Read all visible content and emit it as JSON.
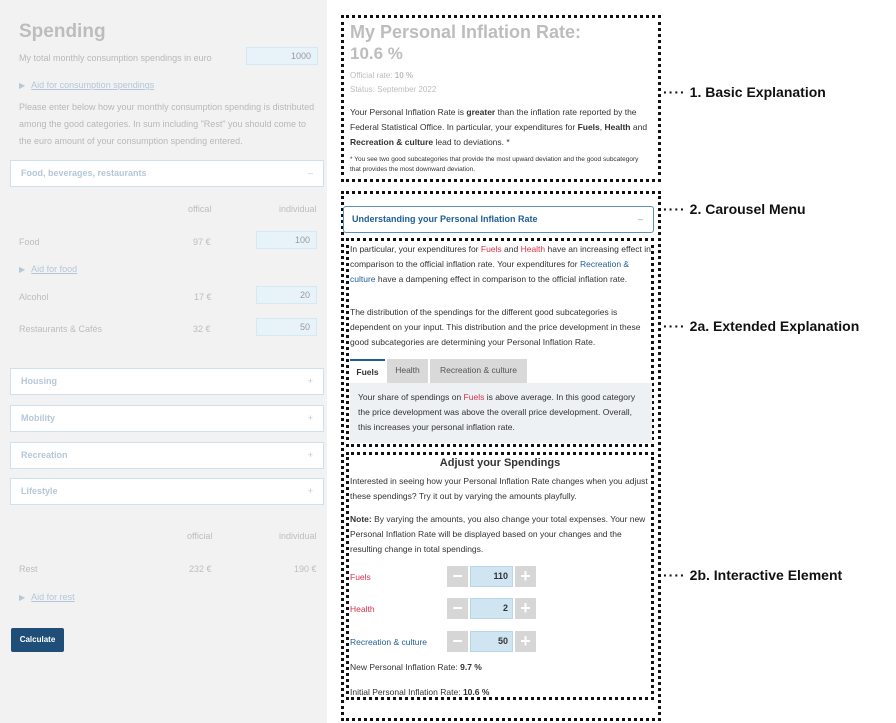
{
  "spending": {
    "title": "Spending",
    "total_label": "My total monthly consumption spendings in euro",
    "total_value": "1000",
    "aid_consumption": "Aid for consumption spendings",
    "instructions": "Please enter below how your monthly consumption spending is distributed among the good categories. In sum including \"Rest\" you should come to the euro amount of your consumption spending entered.",
    "categories": {
      "food": {
        "label": "Food, beverages, restaurants",
        "sign": "–"
      },
      "housing": {
        "label": "Housing",
        "sign": "+"
      },
      "mobility": {
        "label": "Mobility",
        "sign": "+"
      },
      "recreation": {
        "label": "Recreation",
        "sign": "+"
      },
      "lifestyle": {
        "label": "Lifestyle",
        "sign": "+"
      }
    },
    "food_table": {
      "col_official": "offical",
      "col_individual": "individual",
      "rows": [
        {
          "name": "Food",
          "official": "97 €",
          "individual": "100"
        },
        {
          "name": "Alcohol",
          "official": "17 €",
          "individual": "20"
        },
        {
          "name": "Restaurants & Cafés",
          "official": "32 €",
          "individual": "50"
        }
      ],
      "aid_food": "Aid for food"
    },
    "rest_table": {
      "col_official": "official",
      "col_individual": "individual",
      "name": "Rest",
      "official": "232 €",
      "individual": "190 €",
      "aid_rest": "Aid for rest"
    },
    "calculate": "Calculate"
  },
  "result": {
    "title": "My Personal Inflation Rate:",
    "rate": "10.6 %",
    "official_rate_label": "Official rate:",
    "official_rate_value": "10 %",
    "status": "Status: September 2022",
    "basic_1": "Your Personal Inflation Rate is ",
    "basic_greater": "greater",
    "basic_2": " than the inflation rate reported by the Federal Statistical Office. In particular, your expenditures for ",
    "basic_fuels": "Fuels",
    "basic_3": ",",
    "basic_health": "Health",
    "basic_4": " and ",
    "basic_rec": "Recreation & culture",
    "basic_5": " lead to deviations. *",
    "footnote": "* You see two good subcategories that provide the most upward deviation and the good subcategory that provides the most downward deviation."
  },
  "carousel": {
    "label": "Understanding your Personal Inflation Rate",
    "sign": "–"
  },
  "extended": {
    "p1_a": "In particular, your expenditures for ",
    "fuels": "Fuels",
    "p1_b": " and ",
    "health": "Health",
    "p1_c": " have an increasing effect in comparison to the official inflation rate. Your expenditures for ",
    "rec": "Recreation & culture",
    "p1_d": " have a dampening effect in comparison to the official inflation rate.",
    "p2": "The distribution of the spendings for the different good subcategories is dependent on your input. This distribution and the price development in these good subcategories are determining your Personal Inflation Rate.",
    "tabs": [
      "Fuels",
      "Health",
      "Recreation & culture"
    ],
    "panel_a": "Your share of spendings on ",
    "panel_fuels": "Fuels",
    "panel_b": " is above average. In this good category the price development was above the overall price development. Overall, this increases your personal inflation rate."
  },
  "adjust": {
    "title": "Adjust your Spendings",
    "intro": "Interested in seeing how your Personal Inflation Rate changes when you adjust these spendings? Try it out by varying the amounts playfully.",
    "note_label": "Note:",
    "note_text": " By varying the amounts, you also change your total expenses. Your new Personal Inflation Rate will be displayed based on your changes and the resulting change in total spendings.",
    "items": [
      {
        "label": "Fuels",
        "value": "110"
      },
      {
        "label": "Health",
        "value": "2"
      },
      {
        "label": "Recreation & culture",
        "value": "50"
      }
    ],
    "new_rate_label": "New Personal Inflation Rate:",
    "new_rate_value": "9.7 %",
    "initial_rate_label": "Initial Personal Inflation Rate:",
    "initial_rate_value": "10.6 %"
  },
  "annotations": {
    "a1": "1. Basic Explanation",
    "a2": "2. Carousel Menu",
    "a2a": "2a. Extended Explanation",
    "a2b": "2b. Interactive Element",
    "dots": "····"
  }
}
